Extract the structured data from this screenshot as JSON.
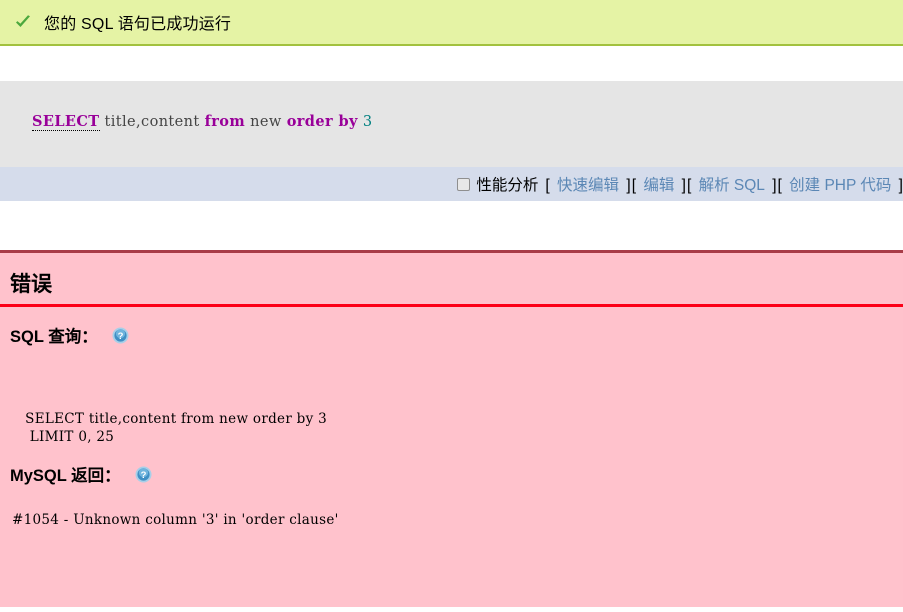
{
  "success": {
    "icon": "check-icon",
    "message": "您的 SQL 语句已成功运行"
  },
  "sql_display": {
    "keyword_select": "SELECT",
    "columns": " title,content ",
    "keyword_from": "from",
    "table": " new ",
    "keyword_order_by": "order by",
    "order_value": " 3"
  },
  "action_bar": {
    "profiling_label": "性能分析",
    "checkbox_name": "profiling-checkbox",
    "links": [
      {
        "open": "[ ",
        "label": "快速编辑",
        "close": " ]"
      },
      {
        "open": "[ ",
        "label": "编辑",
        "close": " ]"
      },
      {
        "open": "[ ",
        "label": "解析 SQL",
        "close": " ]"
      },
      {
        "open": "[ ",
        "label": "创建 PHP 代码",
        "close": " ]"
      }
    ]
  },
  "error": {
    "title": "错误",
    "query_label": "SQL 查询：",
    "query_help_icon": "help-icon",
    "query_text": "  SELECT title,content from new order by 3\n   LIMIT 0, 25",
    "return_label": "MySQL 返回：",
    "return_help_icon": "help-icon",
    "message": "#1054 - Unknown column '3' in 'order clause'"
  },
  "colors": {
    "success_bg": "#e5f3a5",
    "success_border": "#a2c13e",
    "sql_box_bg": "#e5e5e5",
    "action_bar_bg": "#d5dceb",
    "error_bg": "#ffc2cc",
    "error_top_border": "#a83c48",
    "error_rule": "#fc0017",
    "link": "#5b87b5",
    "keyword": "#990099",
    "number": "#008080"
  }
}
